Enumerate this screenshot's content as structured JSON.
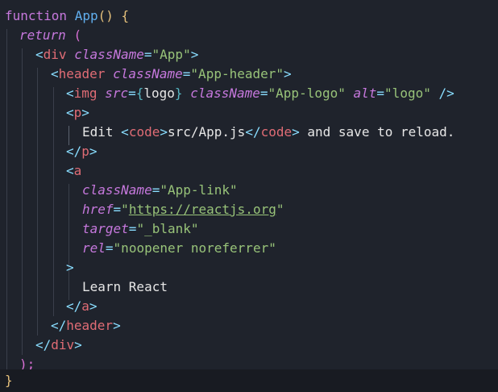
{
  "code": {
    "fn_keyword": "function",
    "fn_name": "App",
    "fn_parens": "()",
    "open_brace": "{",
    "return_keyword": "return",
    "return_paren": "(",
    "div_tag": "div",
    "header_tag": "header",
    "img_tag": "img",
    "p_tag": "p",
    "a_tag": "a",
    "code_tag": "code",
    "attr_className": "className",
    "attr_src": "src",
    "attr_alt": "alt",
    "attr_href": "href",
    "attr_target": "target",
    "attr_rel": "rel",
    "val_app": "\"App\"",
    "val_app_header": "\"App-header\"",
    "val_logo_expr": "logo",
    "val_app_logo": "\"App-logo\"",
    "val_alt_logo": "\"logo\"",
    "text_edit": "Edit ",
    "text_path": "src/App.js",
    "text_reload": " and save to reload.",
    "val_app_link": "\"App-link\"",
    "val_href_url": "https://reactjs.org",
    "val_target": "\"_blank\"",
    "val_rel": "\"noopener noreferrer\"",
    "text_learn": "Learn React",
    "close_return": ");",
    "close_brace": "}"
  },
  "colors": {
    "background": "#1f232c",
    "keyword": "#c678dd",
    "function": "#61afef",
    "tag": "#e06c75",
    "string": "#98c379",
    "punctuation": "#89ddff",
    "brace": "#e5c07b"
  }
}
